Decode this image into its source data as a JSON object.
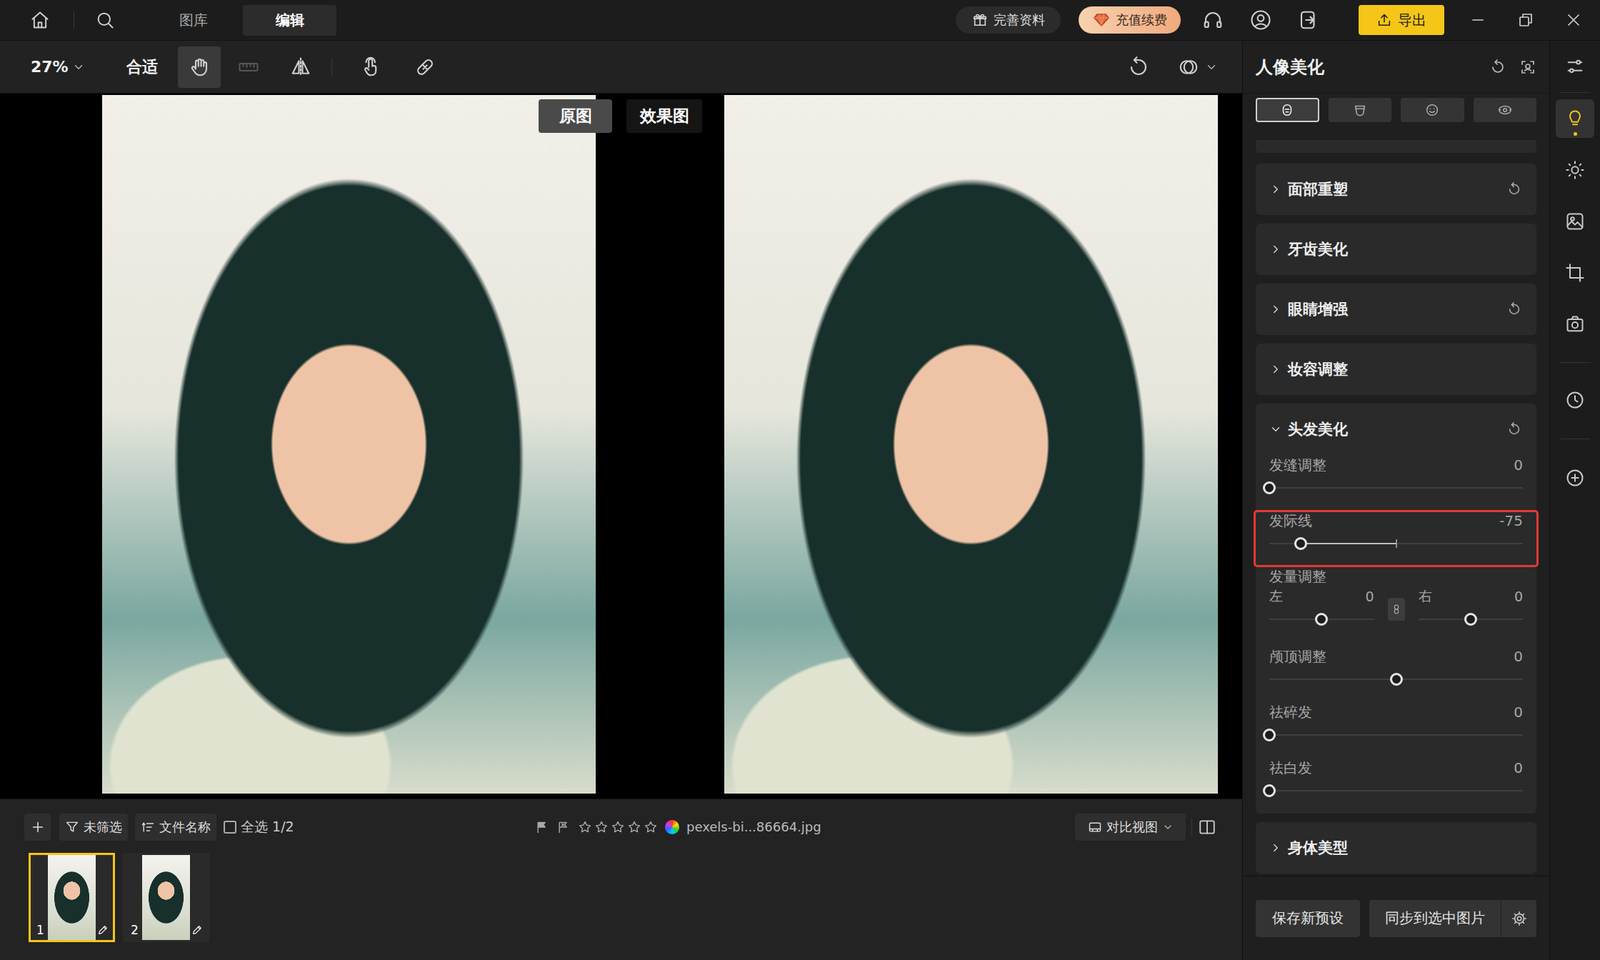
{
  "topbar": {
    "tabs": [
      {
        "label": "图库",
        "selected": false
      },
      {
        "label": "编辑",
        "selected": true
      }
    ],
    "profile_button": "完善资料",
    "recharge_button": "充值续费",
    "export_button": "导出"
  },
  "toolbar": {
    "zoom": "27%",
    "fit": "合适",
    "tools": [
      {
        "kind": "hand",
        "selected": true,
        "disabled": false
      },
      {
        "kind": "ruler",
        "selected": false,
        "disabled": true
      },
      {
        "kind": "flip",
        "selected": false,
        "disabled": false
      },
      {
        "kind": "touch",
        "selected": false,
        "disabled": false
      },
      {
        "kind": "patch",
        "selected": false,
        "disabled": false
      }
    ]
  },
  "canvas": {
    "original_label": "原图",
    "result_label": "效果图"
  },
  "filmstrip": {
    "filter_button": "未筛选",
    "sort_button": "文件名称",
    "select_all": {
      "label": "全选 1/2",
      "checked": false
    },
    "stars": 0,
    "filename": "pexels-bi...86664.jpg",
    "view_mode": "对比视图",
    "thumbnails": [
      {
        "number": "1",
        "selected": true
      },
      {
        "number": "2",
        "selected": false
      }
    ]
  },
  "panel": {
    "title": "人像美化",
    "tabs": [
      {
        "kind": "face",
        "selected": true
      },
      {
        "kind": "mouth",
        "selected": false
      },
      {
        "kind": "smile",
        "selected": false
      },
      {
        "kind": "eyes",
        "selected": false
      }
    ],
    "sections": [
      {
        "title": "面部重塑",
        "expanded": false,
        "modified": true
      },
      {
        "title": "牙齿美化",
        "expanded": false,
        "modified": false
      },
      {
        "title": "眼睛增强",
        "expanded": false,
        "modified": true
      },
      {
        "title": "妆容调整",
        "expanded": false,
        "modified": false
      },
      {
        "title": "头发美化",
        "expanded": true,
        "modified": true,
        "controls": [
          {
            "kind": "slider",
            "label": "发缝调整",
            "value": "0",
            "level": 0,
            "highlighted": false
          },
          {
            "kind": "bipolar",
            "label": "发际线",
            "value": "-75",
            "level": 0.125,
            "highlighted": true
          },
          {
            "kind": "pair",
            "label": "发量调整",
            "highlighted": false,
            "sides": [
              {
                "label": "左",
                "value": "0",
                "level": 0.5
              },
              {
                "label": "右",
                "value": "0",
                "level": 0.5
              }
            ]
          },
          {
            "kind": "bipolar",
            "label": "颅顶调整",
            "value": "0",
            "level": 0.5,
            "highlighted": false
          },
          {
            "kind": "slider",
            "label": "祛碎发",
            "value": "0",
            "level": 0,
            "highlighted": false
          },
          {
            "kind": "slider",
            "label": "祛白发",
            "value": "0",
            "level": 0,
            "highlighted": false
          }
        ]
      },
      {
        "title": "身体美型",
        "expanded": false,
        "modified": false
      }
    ],
    "buttons": [
      "保存新预设",
      "同步到选中图片"
    ]
  },
  "sidebar": {
    "items": [
      {
        "kind": "adjust",
        "selected": false
      },
      {
        "kind": "portrait",
        "selected": true
      },
      {
        "kind": "light",
        "selected": false
      },
      {
        "kind": "color",
        "selected": false
      },
      {
        "kind": "crop",
        "selected": false
      },
      {
        "kind": "camera",
        "selected": false
      },
      {
        "kind": "history",
        "selected": false
      },
      {
        "kind": "add",
        "selected": false
      }
    ]
  }
}
